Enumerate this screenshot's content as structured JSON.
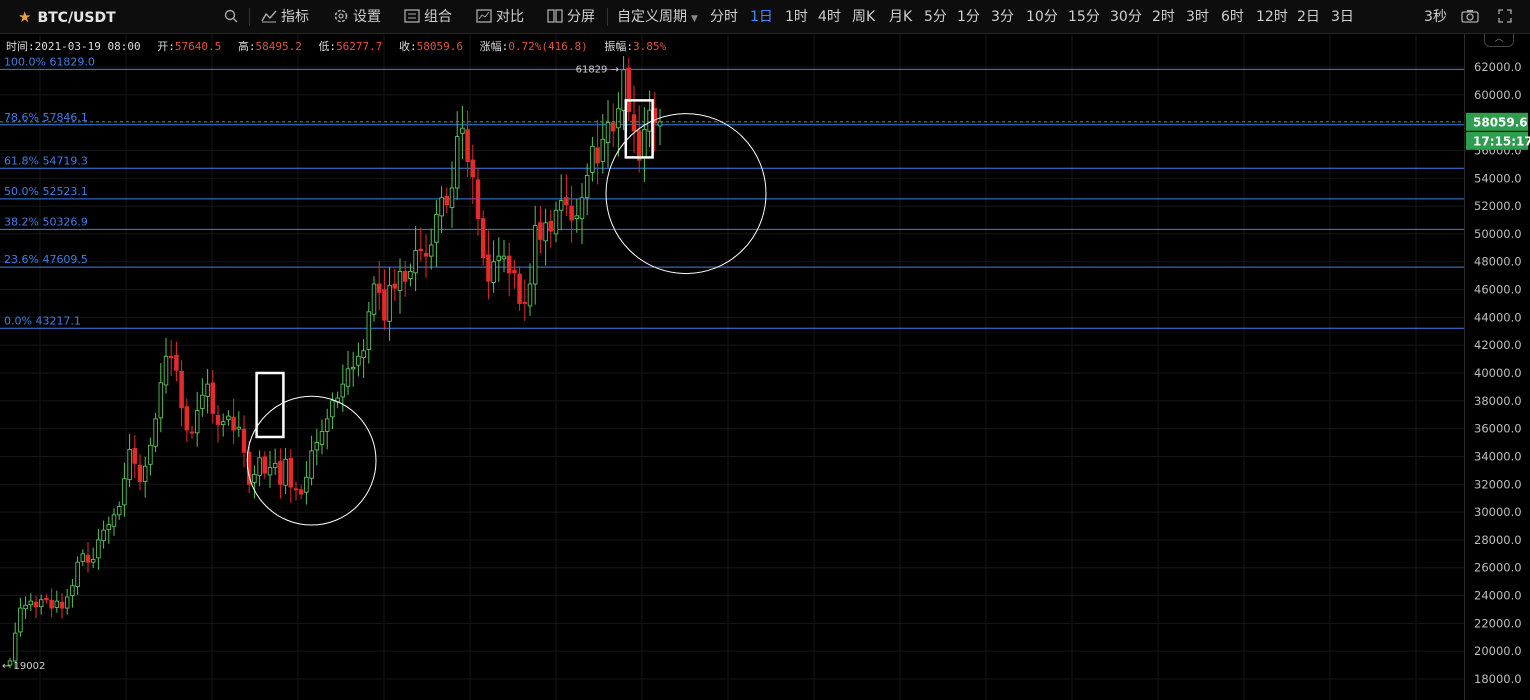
{
  "toolbar": {
    "symbol": "BTC/USDT",
    "search_icon": "search-icon",
    "tools": [
      {
        "label": "指标",
        "icon": "indicator-icon"
      },
      {
        "label": "设置",
        "icon": "gear-icon"
      },
      {
        "label": "组合",
        "icon": "layout-icon"
      },
      {
        "label": "对比",
        "icon": "compare-icon"
      },
      {
        "label": "分屏",
        "icon": "split-screen-icon"
      }
    ],
    "custom_period": "自定义周期",
    "periods": [
      "分时",
      "1日",
      "1时",
      "4时",
      "周K",
      "月K",
      "5分",
      "1分",
      "3分",
      "10分",
      "15分",
      "30分",
      "2时",
      "3时",
      "6时",
      "12时",
      "2日",
      "3日"
    ],
    "active_period": "1日",
    "refresh": "3秒"
  },
  "info": {
    "time_label": "时间:",
    "time": "2021-03-19 08:00",
    "open_label": "开:",
    "open": "57640.5",
    "high_label": "高:",
    "high": "58495.2",
    "low_label": "低:",
    "low": "56277.7",
    "close_label": "收:",
    "close": "58059.6",
    "change_label": "涨幅:",
    "change": "0.72%(416.8)",
    "amp_label": "振幅:",
    "amp": "3.85%"
  },
  "price_tag": "58059.6",
  "countdown_tag": "17:15:17",
  "high_mark": "61829",
  "low_mark": "19002",
  "colors": {
    "up": "#58c35c",
    "down": "#e32b2b",
    "fib": "#3e7fe6",
    "axis_text": "#bdbdbd",
    "tag": "#2e9d4e"
  },
  "chart_data": {
    "type": "candlestick",
    "ylim": [
      17000,
      63000
    ],
    "y_ticks": [
      "18000.0",
      "20000.0",
      "22000.0",
      "24000.0",
      "26000.0",
      "28000.0",
      "30000.0",
      "32000.0",
      "34000.0",
      "36000.0",
      "38000.0",
      "40000.0",
      "42000.0",
      "44000.0",
      "46000.0",
      "48000.0",
      "50000.0",
      "52000.0",
      "54000.0",
      "56000.0",
      "58000.0",
      "60000.0",
      "62000.0"
    ],
    "fib_levels": [
      {
        "label": "100.0% 61829.0",
        "value": 61829.0
      },
      {
        "label": "78.6% 57846.1",
        "value": 57846.1
      },
      {
        "label": "61.8% 54719.3",
        "value": 54719.3
      },
      {
        "label": "50.0% 52523.1",
        "value": 52523.1
      },
      {
        "label": "38.2% 50326.9",
        "value": 50326.9
      },
      {
        "label": "23.6% 47609.5",
        "value": 47609.5
      },
      {
        "label": "0.0% 43217.1",
        "value": 43217.1
      }
    ],
    "closes": [
      19300,
      21300,
      23100,
      23300,
      23600,
      23200,
      23700,
      23700,
      23100,
      23600,
      23100,
      23900,
      24700,
      26400,
      27000,
      26400,
      26600,
      28000,
      28700,
      29100,
      29800,
      30400,
      32400,
      34500,
      33500,
      32200,
      33300,
      34800,
      36700,
      39300,
      41200,
      41100,
      40200,
      37500,
      35900,
      35700,
      37300,
      38400,
      39200,
      37100,
      36300,
      36500,
      36900,
      35900,
      36100,
      34300,
      32000,
      32700,
      33900,
      32800,
      33200,
      33500,
      32000,
      33800,
      31800,
      31600,
      31300,
      32500,
      34400,
      35000,
      35800,
      36700,
      38000,
      38200,
      39200,
      40300,
      40400,
      41200,
      41600,
      44400,
      46400,
      45800,
      43800,
      46300,
      46100,
      47300,
      46600,
      47300,
      48800,
      48800,
      48400,
      49200,
      51400,
      52600,
      52100,
      53300,
      57000,
      57600,
      55200,
      54100,
      51100,
      48300,
      46600,
      48000,
      48400,
      48400,
      47200,
      47200,
      45000,
      45000,
      46400,
      50600,
      49600,
      50800,
      50200,
      51700,
      52400,
      52100,
      51000,
      51300,
      52600,
      54200,
      56300,
      55100,
      56800,
      58000,
      57400,
      59000,
      61800,
      58800,
      57400,
      55300,
      57500,
      58900,
      58000,
      58059.6
    ],
    "annotations": [
      {
        "type": "rect",
        "from_index": 48,
        "to_index": 52,
        "y_from": 35400,
        "y_to": 40000
      },
      {
        "type": "circle",
        "center_index": 58,
        "center_value": 33700,
        "radius_candles": 12
      },
      {
        "type": "rect",
        "from_index": 119,
        "to_index": 123,
        "y_from": 55500,
        "y_to": 59600
      },
      {
        "type": "circle",
        "center_index": 130,
        "center_value": 52900,
        "radius_candles": 15
      }
    ]
  }
}
